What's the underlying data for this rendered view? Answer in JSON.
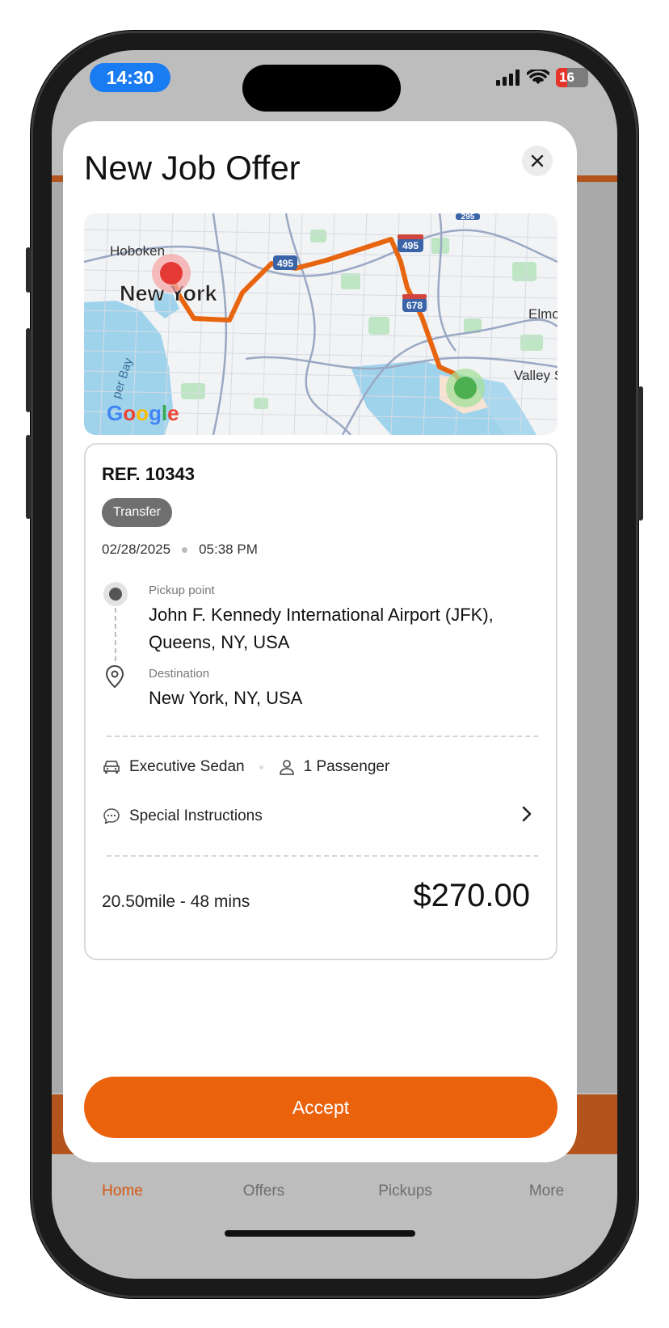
{
  "status_bar": {
    "time": "14:30",
    "battery": "16",
    "signal_icon": "cellular-signal-icon",
    "wifi_icon": "wifi-icon"
  },
  "modal": {
    "title": "New Job Offer",
    "close_icon": "close-icon"
  },
  "map": {
    "labels": {
      "hoboken": "Hoboken",
      "new_york": "New York",
      "elmont": "Elmo",
      "valley": "Valley S",
      "bay": "per Bay",
      "highway_495_a": "495",
      "highway_495_b": "495",
      "highway_678": "678",
      "highway_295": "295"
    },
    "logo": "Google",
    "route_color": "#e8650f",
    "pickup_color": "#e53935",
    "destination_color": "#4caf50"
  },
  "job": {
    "ref": "REF. 10343",
    "type_badge": "Transfer",
    "date": "02/28/2025",
    "time": "05:38 PM",
    "pickup_label": "Pickup point",
    "pickup_address": "John F. Kennedy International Airport (JFK), Queens, NY, USA",
    "destination_label": "Destination",
    "destination_address": "New York, NY, USA",
    "vehicle": "Executive Sedan",
    "passengers": "1 Passenger",
    "special_instructions": "Special Instructions",
    "distance_time": "20.50mile - 48 mins",
    "price": "$270.00"
  },
  "actions": {
    "accept_label": "Accept",
    "accept_color": "#ea620c"
  },
  "tabbar": {
    "tabs": [
      {
        "label": "Home",
        "active": true
      },
      {
        "label": "Offers",
        "active": false
      },
      {
        "label": "Pickups",
        "active": false
      },
      {
        "label": "More",
        "active": false
      }
    ]
  }
}
